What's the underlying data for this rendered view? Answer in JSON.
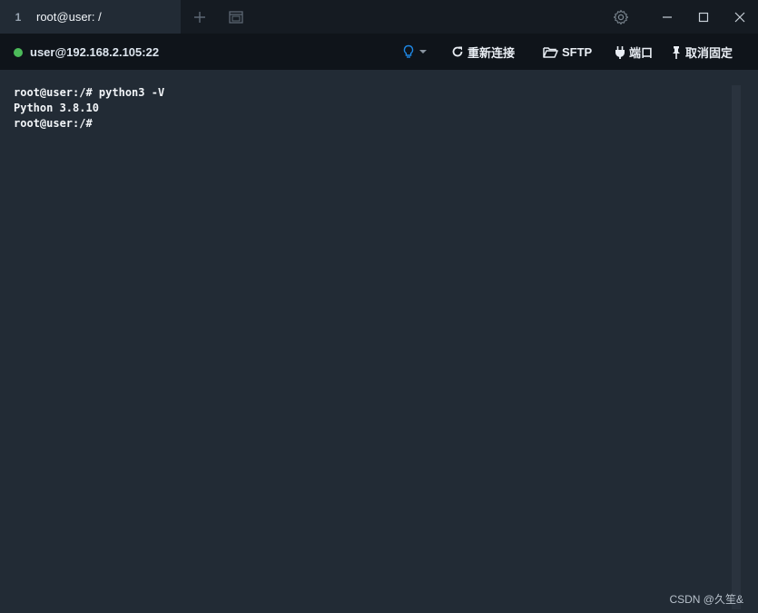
{
  "tabbar": {
    "active_tab": {
      "index": "1",
      "title": "root@user: /"
    },
    "icons": {
      "new_tab": "plus-icon",
      "new_window": "window-icon",
      "settings": "gear-icon",
      "minimize": "minimize-icon",
      "maximize": "maximize-icon",
      "close": "close-icon"
    }
  },
  "toolbar": {
    "connection": {
      "status_color": "#4cbb5a",
      "label": "user@192.168.2.105:22"
    },
    "hint_icon": "lightbulb-icon",
    "reconnect_label": "重新连接",
    "sftp_label": "SFTP",
    "port_label": "端口",
    "unpin_label": "取消固定"
  },
  "terminal": {
    "lines": [
      "root@user:/# python3 -V",
      "Python 3.8.10",
      "root@user:/#"
    ]
  },
  "watermark": "CSDN @久笙&",
  "colors": {
    "background": "#222b35",
    "titlebar": "#151b22",
    "toolbar": "#0f141a",
    "accent": "#1e88e5"
  }
}
